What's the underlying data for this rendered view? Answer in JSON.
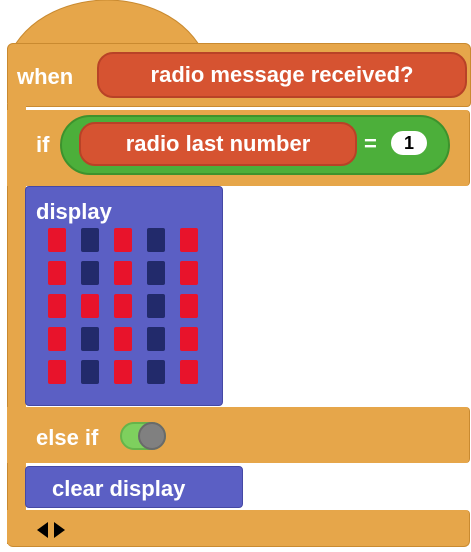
{
  "when_block": {
    "keyword": "when",
    "event": "radio message received?"
  },
  "if_block": {
    "keyword": "if",
    "reporter": "radio last number",
    "operator": "=",
    "value": "1"
  },
  "display_block": {
    "label": "display",
    "led_rows": [
      [
        1,
        0,
        1,
        0,
        1
      ],
      [
        1,
        0,
        1,
        0,
        1
      ],
      [
        1,
        1,
        1,
        0,
        1
      ],
      [
        1,
        0,
        1,
        0,
        1
      ],
      [
        1,
        0,
        1,
        0,
        1
      ]
    ]
  },
  "else_if_block": {
    "keyword": "else if",
    "toggle_state": "on"
  },
  "clear_block": {
    "label": "clear display"
  },
  "colors": {
    "control": "#e6a64a",
    "sensing": "#d65331",
    "operator": "#4caf3a",
    "display": "#5b5fc4",
    "led_on": "#e8132b",
    "led_off": "#222a6b"
  },
  "icons": {
    "expand_arrows": "left-right-arrows-icon"
  }
}
